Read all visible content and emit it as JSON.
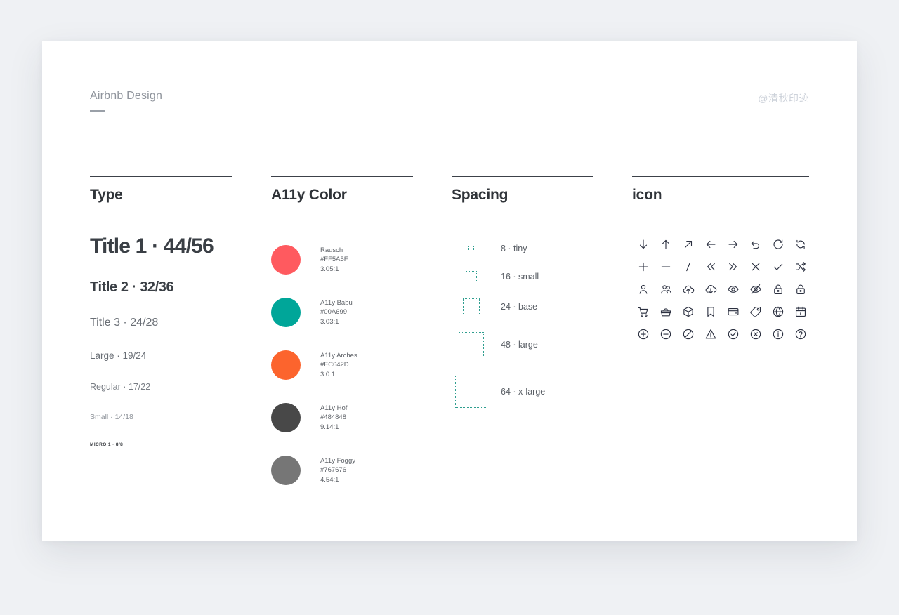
{
  "header": {
    "brand": "Airbnb Design",
    "watermark": "@清秋印迹"
  },
  "colors": {
    "background": "#eff1f4",
    "card": "#ffffff",
    "rule": "#3c4149",
    "spacing_accent": "#2f9e8f",
    "icon_stroke": "#2b3040"
  },
  "columns": {
    "type": {
      "title": "Type",
      "samples": [
        {
          "label": "Title 1 · 44/56"
        },
        {
          "label": "Title 2 · 32/36"
        },
        {
          "label": "Title 3 · 24/28"
        },
        {
          "label": "Large · 19/24"
        },
        {
          "label": "Regular · 17/22"
        },
        {
          "label": "Small · 14/18"
        },
        {
          "label": "MICRO 1 · 8/8"
        }
      ]
    },
    "color": {
      "title": "A11y Color",
      "swatches": [
        {
          "name": "Rausch",
          "hex": "#FF5A5F",
          "contrast": "3.05:1"
        },
        {
          "name": "A11y Babu",
          "hex": "#00A699",
          "contrast": "3.03:1"
        },
        {
          "name": "A11y Arches",
          "hex": "#FC642D",
          "contrast": "3.0:1"
        },
        {
          "name": "A11y Hof",
          "hex": "#484848",
          "contrast": "9.14:1"
        },
        {
          "name": "A11y Foggy",
          "hex": "#767676",
          "contrast": "4.54:1"
        }
      ]
    },
    "spacing": {
      "title": "Spacing",
      "tokens": [
        {
          "label": "8 · tiny",
          "size": 8
        },
        {
          "label": "16 · small",
          "size": 16
        },
        {
          "label": "24 · base",
          "size": 24
        },
        {
          "label": "48 · large",
          "size": 36
        },
        {
          "label": "64 · x-large",
          "size": 46
        }
      ]
    },
    "icon": {
      "title": "icon",
      "icons": [
        "arrow-down-icon",
        "arrow-up-icon",
        "arrow-up-right-icon",
        "arrow-left-icon",
        "arrow-right-icon",
        "undo-icon",
        "refresh-icon",
        "sync-icon",
        "plus-icon",
        "minus-icon",
        "slash-icon",
        "chevrons-left-icon",
        "chevrons-right-icon",
        "close-icon",
        "check-icon",
        "shuffle-icon",
        "user-icon",
        "users-icon",
        "cloud-upload-icon",
        "cloud-download-icon",
        "eye-icon",
        "eye-off-icon",
        "lock-icon",
        "unlock-icon",
        "shopping-cart-icon",
        "basket-icon",
        "box-icon",
        "bookmark-icon",
        "credit-card-icon",
        "tag-icon",
        "globe-icon",
        "calendar-icon",
        "plus-circle-icon",
        "minus-circle-icon",
        "block-icon",
        "warning-triangle-icon",
        "check-circle-icon",
        "x-circle-icon",
        "info-circle-icon",
        "help-circle-icon"
      ]
    }
  }
}
